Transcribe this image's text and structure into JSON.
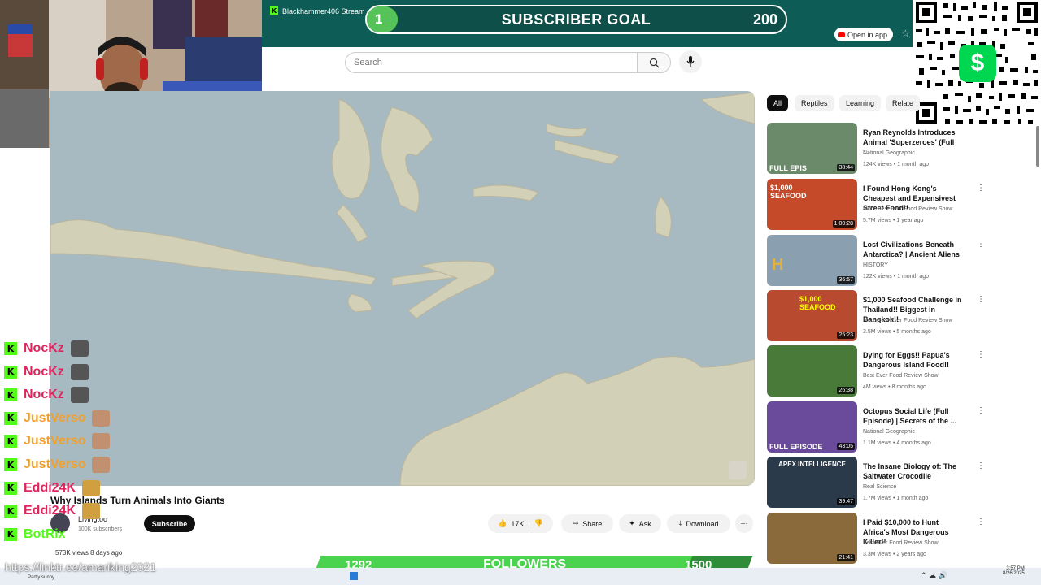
{
  "browser": {
    "tab_title": "Blackhammer406 Stream - W",
    "open_in_app": "Open in app",
    "new_tab": "+"
  },
  "subscriber_goal": {
    "current": "1",
    "title": "SUBSCRIBER GOAL",
    "target": "200",
    "progress": 0.005
  },
  "search": {
    "placeholder": "Search"
  },
  "video": {
    "title": "Why Islands Turn Animals Into Giants",
    "channel": "Livingtoo",
    "subscribers": "100K subscribers",
    "subscribe_label": "Subscribe",
    "likes": "17K",
    "share": "Share",
    "ask": "Ask",
    "download": "Download",
    "views_date": "573K views  8 days ago"
  },
  "chips": [
    "All",
    "Reptiles",
    "Learning",
    "Relate"
  ],
  "recommendations": [
    {
      "title": "Ryan Reynolds Introduces Animal 'Superzeroes' (Full ...",
      "channel": "National Geographic",
      "meta": "124K views • 1 month ago",
      "duration": "38:44",
      "overlay": "FULL EPIS"
    },
    {
      "title": "I Found Hong Kong's Cheapest and Expensivest Street Food!!",
      "channel": "More Best Ever Food Review Show",
      "meta": "5.7M views • 1 year ago",
      "duration": "1:00:28",
      "overlay": "$1,000 SEAFOOD"
    },
    {
      "title": "Lost Civilizations Beneath Antarctica? | Ancient Aliens",
      "channel": "HISTORY",
      "meta": "122K views • 1 month ago",
      "duration": "36:57",
      "overlay": "H"
    },
    {
      "title": "$1,000 Seafood Challenge in Thailand!! Biggest in Bangkok!!",
      "channel": "More Best Ever Food Review Show",
      "meta": "3.5M views • 5 months ago",
      "duration": "25:23",
      "overlay": "$1,000 SEAFOOD"
    },
    {
      "title": "Dying for Eggs!! Papua's Dangerous Island Food!!",
      "channel": "Best Ever Food Review Show",
      "meta": "4M views • 8 months ago",
      "duration": "26:38",
      "overlay": ""
    },
    {
      "title": "Octopus Social Life (Full Episode) | Secrets of the ...",
      "channel": "National Geographic",
      "meta": "1.1M views • 4 months ago",
      "duration": "43:05",
      "overlay": "FULL EPISODE"
    },
    {
      "title": "The Insane Biology of: The Saltwater Crocodile",
      "channel": "Real Science",
      "meta": "1.7M views • 1 month ago",
      "duration": "39:47",
      "overlay": "APEX INTELLIGENCE"
    },
    {
      "title": "I Paid $10,000 to Hunt Africa's Most Dangerous Killer!!",
      "channel": "Best Ever Food Review Show",
      "meta": "3.3M views • 2 years ago",
      "duration": "21:41",
      "overlay": ""
    }
  ],
  "chat": [
    {
      "name": "NocKz",
      "color": "#e0245e"
    },
    {
      "name": "NocKz",
      "color": "#e0245e"
    },
    {
      "name": "NocKz",
      "color": "#e0245e"
    },
    {
      "name": "JustVerso",
      "color": "#f0a030"
    },
    {
      "name": "JustVerso",
      "color": "#f0a030"
    },
    {
      "name": "JustVerso",
      "color": "#f0a030"
    },
    {
      "name": "Eddi24K",
      "color": "#e0245e"
    },
    {
      "name": "Eddi24K",
      "color": "#e0245e"
    },
    {
      "name": "BotRix",
      "color": "#53fc18"
    }
  ],
  "followers_goal": {
    "current": "1292",
    "title": "FOLLOWERS",
    "target": "1500",
    "progress": 0.86
  },
  "overlay": {
    "linktree": "https://linktr.ee/amariking2021"
  },
  "taskbar": {
    "weather": "Partly sunny",
    "time": "3:57 PM",
    "date": "8/26/2025"
  },
  "cashapp_symbol": "$"
}
